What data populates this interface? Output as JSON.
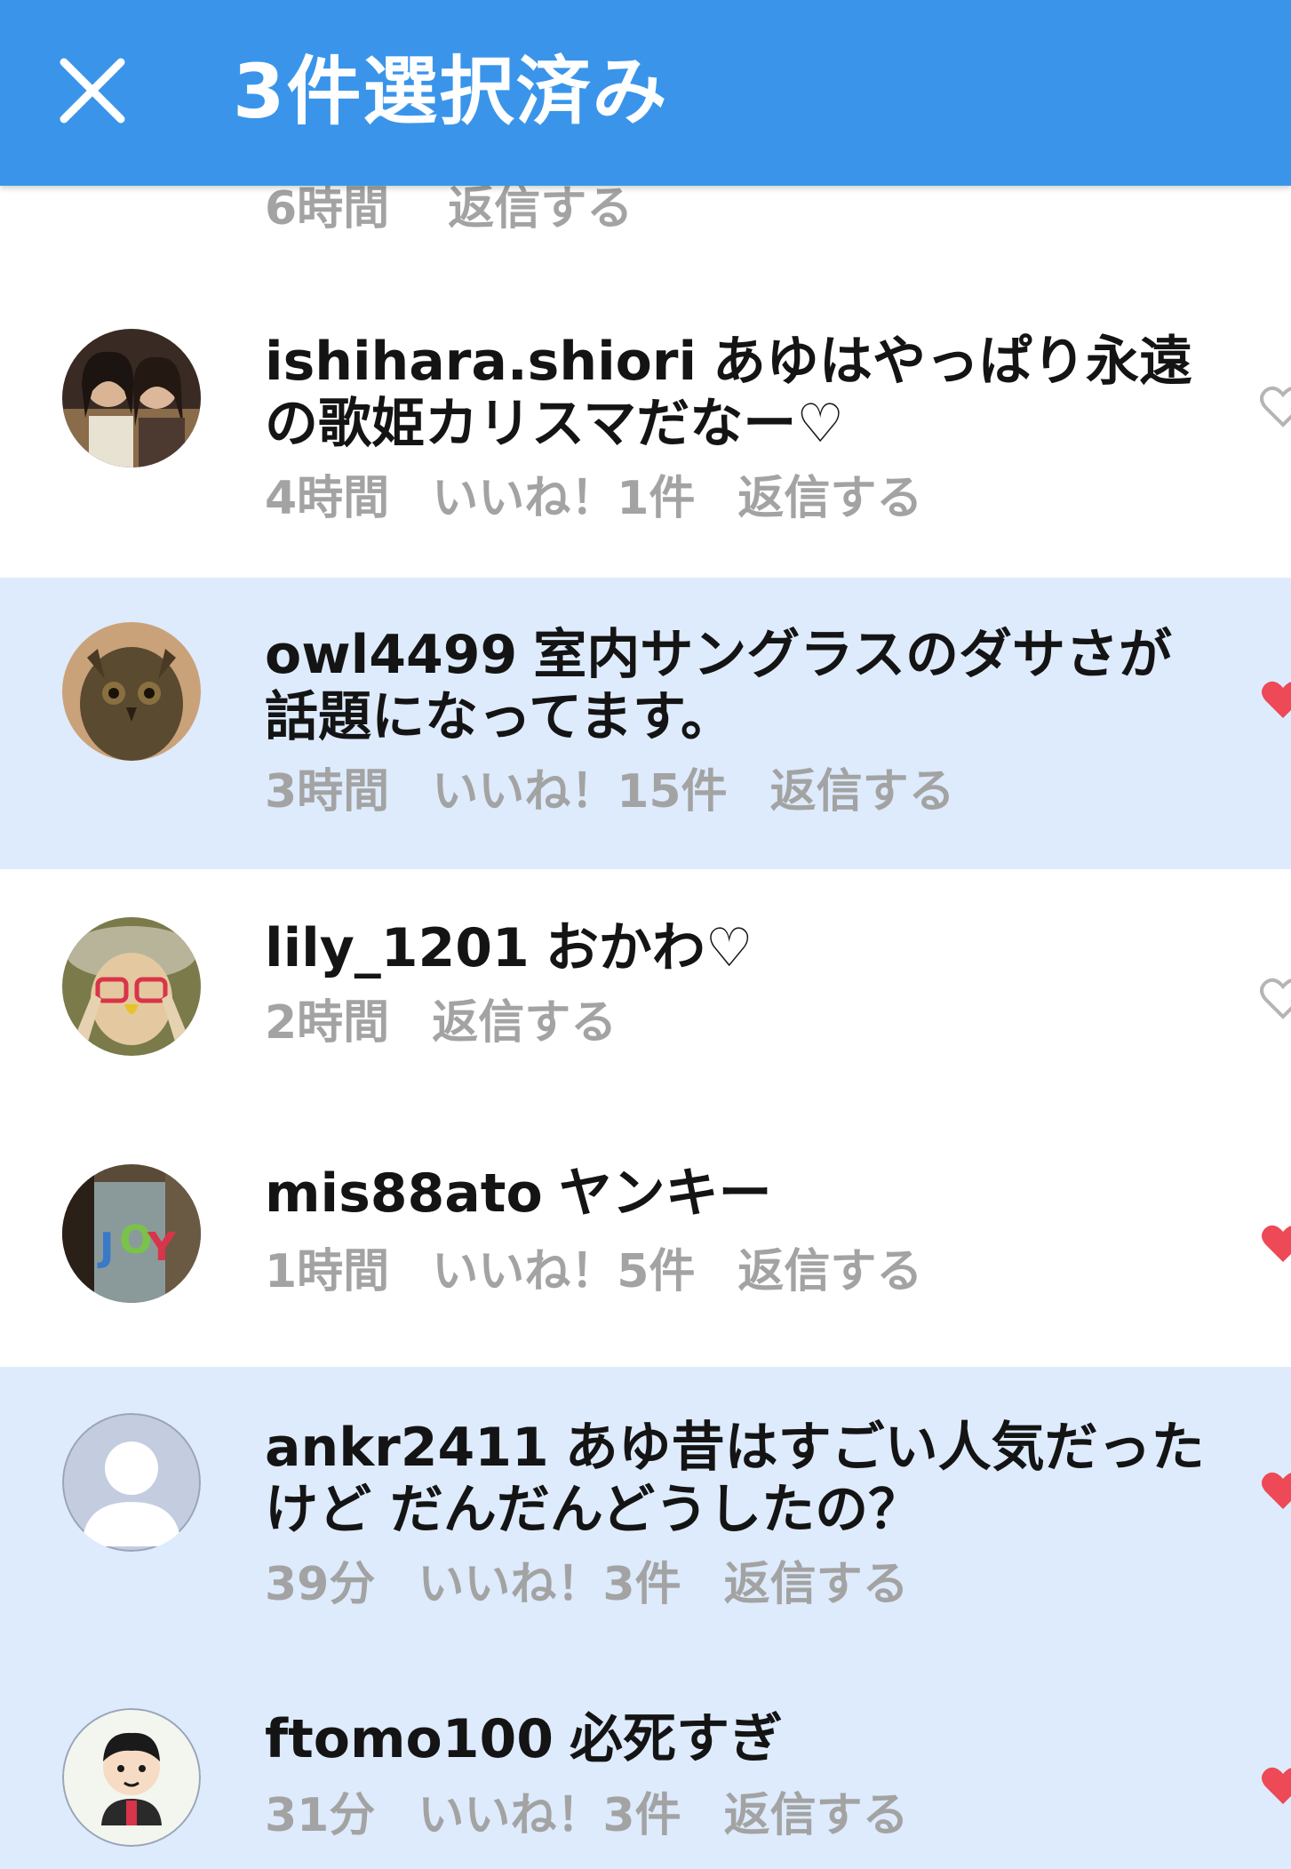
{
  "appbar": {
    "title": "3件選択済み",
    "close_icon": "close-icon",
    "background": "#3a95ea"
  },
  "partial_row": {
    "time": "6時間",
    "reply": "返信する"
  },
  "colors": {
    "selected_row": "#ddebfc",
    "meta_text": "#a3a3a3",
    "heart_liked": "#ed4956",
    "heart_outline": "#b5b5b5"
  },
  "comments": [
    {
      "username": "ishihara.shiori",
      "text": "あゆはやっぱり永遠の歌姫カリスマだなー♡",
      "time": "4時間",
      "likes": "いいね！1件",
      "reply": "返信する",
      "selected": false,
      "liked": false
    },
    {
      "username": "owl4499",
      "text": "室内サングラスのダサさが話題になってます。",
      "time": "3時間",
      "likes": "いいね！15件",
      "reply": "返信する",
      "selected": true,
      "liked": true
    },
    {
      "username": "lily_1201",
      "text": "おかわ♡",
      "time": "2時間",
      "likes": "",
      "reply": "返信する",
      "selected": false,
      "liked": false
    },
    {
      "username": "mis88ato",
      "text": "ヤンキー",
      "time": "1時間",
      "likes": "いいね！5件",
      "reply": "返信する",
      "selected": false,
      "liked": true
    },
    {
      "username": "ankr2411",
      "text": "あゆ昔はすごい人気だったけど だんだんどうしたの？",
      "time": "39分",
      "likes": "いいね！3件",
      "reply": "返信する",
      "selected": true,
      "liked": true
    },
    {
      "username": "ftomo100",
      "text": "必死すぎ",
      "time": "31分",
      "likes": "いいね！3件",
      "reply": "返信する",
      "selected": true,
      "liked": true
    }
  ]
}
